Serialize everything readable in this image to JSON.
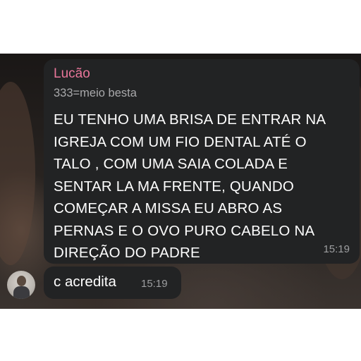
{
  "messages": [
    {
      "sender": "Lucão",
      "role": "333=meio besta",
      "text": "EU TENHO UMA BRISA DE ENTRAR NA\nIGREJA COM UM FIO DENTAL ATÉ O\nTALO , COM UMA SAIA COLADA E\nSENTAR LA MA FRENTE, QUANDO\nCOMEÇAR A MISSA EU ABRO AS\nPERNAS E O OVO PURO CABELO NA\nDIREÇÃO DO PADRE",
      "time": "15:19"
    },
    {
      "text": "c acredita",
      "time": "15:19"
    }
  ],
  "colors": {
    "bubble": "#222324",
    "sender_name": "#e9769a",
    "role": "#a9a9ab",
    "timestamp": "#9d9ea0"
  },
  "icons": {
    "avatar": "user-avatar"
  }
}
